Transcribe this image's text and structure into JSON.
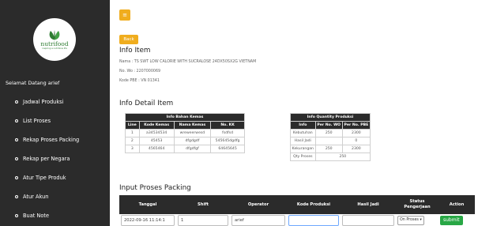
{
  "colors": {
    "sidebar_bg": "#2b2b2b",
    "accent": "#f0ad1e",
    "table_head": "#2b2b2b",
    "submit": "#28a745"
  },
  "sidebar": {
    "logo": {
      "brand": "nutrifood",
      "tagline": "inspiring a nutritious life"
    },
    "welcome": "Selamat Datang arief",
    "items": [
      {
        "label": "Jadwal Produksi"
      },
      {
        "label": "List Proses"
      },
      {
        "label": "Rekap Proses Packing"
      },
      {
        "label": "Rekap per Negara"
      },
      {
        "label": "Atur Tipe Produk"
      },
      {
        "label": "Atur Akun"
      },
      {
        "label": "Buat Note"
      }
    ]
  },
  "header": {
    "menu_icon": "hamburger-icon"
  },
  "main": {
    "back_label": "Back",
    "info_title": "Info Item",
    "info": {
      "nama": "Nama   : TS SWT LOW CALORIE WITH SUCRALOSE 24DX50SX2G VIETNAM",
      "no_wo": "No. Wo   : 2207000069",
      "kode_pbe": "Kode PBE : VN 01341"
    },
    "detail_title": "Info Detail Item",
    "bahan_kemas": {
      "title": "Info Bahan Kemas",
      "headers": [
        "Line",
        "Kode Kemas",
        "Nama Kemas",
        "No. KK"
      ],
      "rows": [
        [
          "1",
          "a34534534",
          "wreweerwesd",
          "fsdfsd"
        ],
        [
          "2",
          "45453",
          "dfgdgdf",
          "545645dgdfg"
        ],
        [
          "3",
          "4565464",
          "dfgdfgf",
          "64645645"
        ]
      ]
    },
    "qty_produksi": {
      "title": "Info Quantity Produksi",
      "headers": [
        "Info",
        "Per No. WO",
        "Per No. PBE"
      ],
      "rows": [
        [
          "Kebutuhan",
          "250",
          "2300"
        ],
        [
          "Hasil Jadi",
          "",
          "0"
        ],
        [
          "Kekurangan",
          "250",
          "2300"
        ]
      ],
      "qty_proses_label": "Qty Proses",
      "qty_proses_value": "250"
    },
    "packing_title": "Input Proses Packing",
    "packing": {
      "headers": {
        "tanggal": "Tanggal",
        "shift": "Shift",
        "operator": "Operator",
        "kode": "Kode Produksi",
        "hasil": "Hasil Jadi",
        "status": "Status Pengerjaan",
        "action": "Action"
      },
      "row": {
        "tanggal": "2022-09-16 11:14:1",
        "shift": "1",
        "operator": "arief",
        "kode": "",
        "hasil": "",
        "status": "On Proses ▾",
        "submit": "submit"
      }
    }
  }
}
